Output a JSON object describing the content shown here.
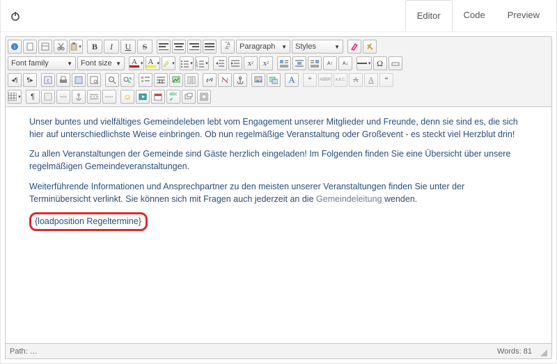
{
  "tabs": {
    "editor": "Editor",
    "code": "Code",
    "preview": "Preview",
    "active": "editor"
  },
  "toolbar": {
    "paragraph_label": "Paragraph",
    "styles_label": "Styles",
    "fontfamily_label": "Font family",
    "fontsize_label": "Font size",
    "bold": "B",
    "italic": "I",
    "underline": "U",
    "strike": "S",
    "abc": "ABC",
    "quote_open": "❝",
    "quote_close": "❝",
    "abbr": "ABBR",
    "abc2": "A.B.C.",
    "letter_a": "A",
    "omega": "Ω",
    "pilcrow": "¶",
    "fcA": "A",
    "bcA": "A"
  },
  "content": {
    "p1": "Unser buntes und vielfältiges Gemeindeleben lebt vom Engagement unserer Mitglieder und Freunde, denn sie sind es, die sich hier auf unterschiedlichste Weise einbringen. Ob nun regelmäßige Veranstaltung oder Großevent - es steckt viel Herzblut drin!",
    "p2": "Zu allen Veranstaltungen der Gemeinde sind Gäste herzlich eingeladen! Im Folgenden finden Sie eine Übersicht über unsere regelmäßigen Gemeindeveranstaltungen.",
    "p3a": "Weiterführende Informationen und Ansprechpartner zu den meisten unserer Veranstaltungen finden Sie unter der Terminübersicht verlinkt. Sie können sich mit Fragen auch jederzeit an die ",
    "p3link": "Gemeindeleitung",
    "p3b": " wenden.",
    "shortcode": "{loadposition Regeltermine}"
  },
  "status": {
    "path_label": "Path: ",
    "path_value": "…",
    "words_label": "Words: ",
    "words_value": "81"
  }
}
